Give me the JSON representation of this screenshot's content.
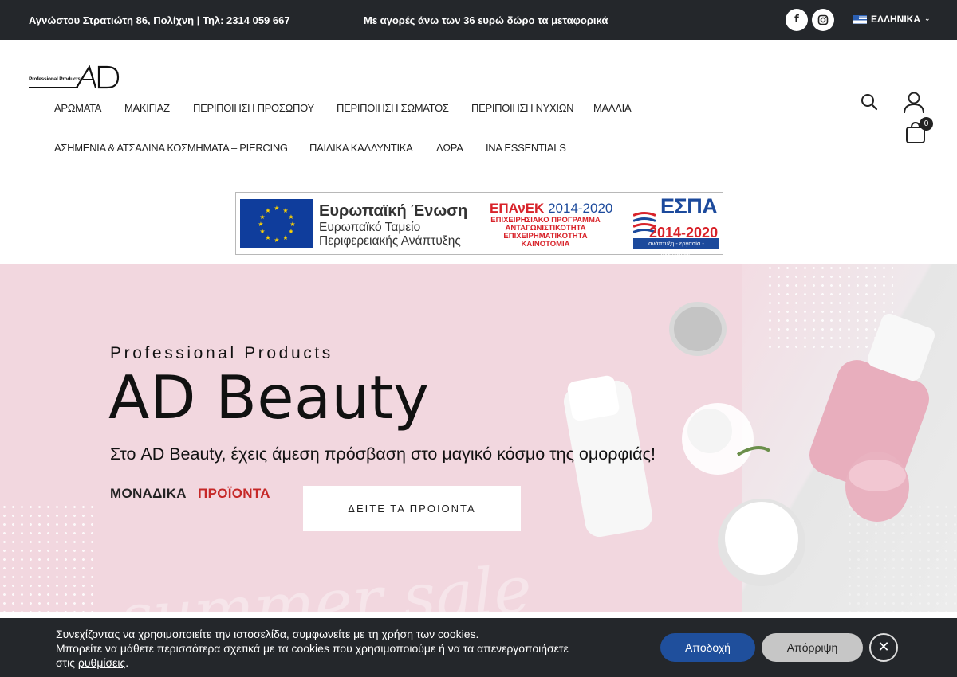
{
  "topbar": {
    "address": "Αγνώστου Στρατιώτη 86, Πολίχνη | Τηλ: 2314 059 667",
    "promo": "Με αγορές άνω των 36 ευρώ δώρο τα μεταφορικά",
    "facebook_glyph": "f",
    "instagram_glyph": "◎",
    "language": "ΕΛΛΗΝΙΚΑ",
    "language_chevron": "⌄"
  },
  "logo": {
    "small_text": "Professional Products",
    "icon": "ad-logo-icon"
  },
  "nav": {
    "row1": [
      "ΑΡΩΜΑΤΑ",
      "ΜΑΚΙΓΙΑΖ",
      "ΠΕΡΙΠΟΙΗΣΗ ΠΡΟΣΩΠΟΥ",
      "ΠΕΡΙΠΟΙΗΣΗ ΣΩΜΑΤΟΣ",
      "ΠΕΡΙΠΟΙΗΣΗ ΝΥΧΙΩΝ",
      "ΜΑΛΛΙΑ"
    ],
    "row2": [
      "ΑΣΗΜΕΝΙΑ & ΑΤΣΑΛΙΝΑ ΚΟΣΜΗΜΑΤΑ – PIERCING",
      "ΠΑΙΔΙΚΑ ΚΑΛΛΥΝΤΙΚΑ",
      "ΔΩΡΑ",
      "INA ESSENTIALS"
    ]
  },
  "header_icons": {
    "search": "search-icon",
    "account": "user-icon",
    "cart": "cart-icon",
    "cart_count": "0"
  },
  "espa": {
    "eu_title": "Ευρωπαϊκή Ένωση",
    "eu_sub1": "Ευρωπαϊκό Ταμείο",
    "eu_sub2": "Περιφερειακής Ανάπτυξης",
    "epanek": "ΕΠΑνΕΚ",
    "epanek_years": "2014-2020",
    "ep_line1": "ΕΠΙΧΕΙΡΗΣΙΑΚΟ ΠΡΟΓΡΑΜΜΑ",
    "ep_line2": "ΑΝΤΑΓΩΝΙΣΤΙΚΟΤΗΤΑ",
    "ep_line3": "ΕΠΙΧΕΙΡΗΜΑΤΙΚΟΤΗΤΑ",
    "ep_line4": "ΚΑΙΝΟΤΟΜΙΑ",
    "espa_title": "ΕΣΠΑ",
    "espa_years": "2014-2020",
    "espa_tag": "ανάπτυξη - εργασία - αλληλεγγύη"
  },
  "hero": {
    "pretitle": "Professional Products",
    "title": "AD Beauty",
    "subtitle": "Στο AD Beauty, έχεις άμεση πρόσβαση στο μαγικό κόσμο της ομορφιάς!",
    "unique_word1": "ΜΟΝΑΔΙΚΑ",
    "unique_word2": "ΠΡΟΪΟΝΤΑ",
    "cta": "ΔΕΙΤΕ ΤΑ ΠΡΟΙΟΝΤΑ",
    "script_text": "summer sale"
  },
  "cookie": {
    "line1": "Συνεχίζοντας να χρησιμοποιείτε την ιστοσελίδα, συμφωνείτε με τη χρήση των cookies.",
    "line2": "Μπορείτε να μάθετε περισσότερα σχετικά με τα cookies που χρησιμοποιούμε ή να τα απενεργοποιήσετε",
    "line3_prefix": "στις ",
    "settings_link": "ρυθμίσεις",
    "line3_suffix": ".",
    "accept": "Αποδοχή",
    "reject": "Απόρριψη",
    "close_glyph": "✕"
  },
  "colors": {
    "topbar_bg": "#24272b",
    "hero_bg": "#f2d7df",
    "accent_red": "#c62828",
    "accept_blue": "#1f4f9c"
  }
}
